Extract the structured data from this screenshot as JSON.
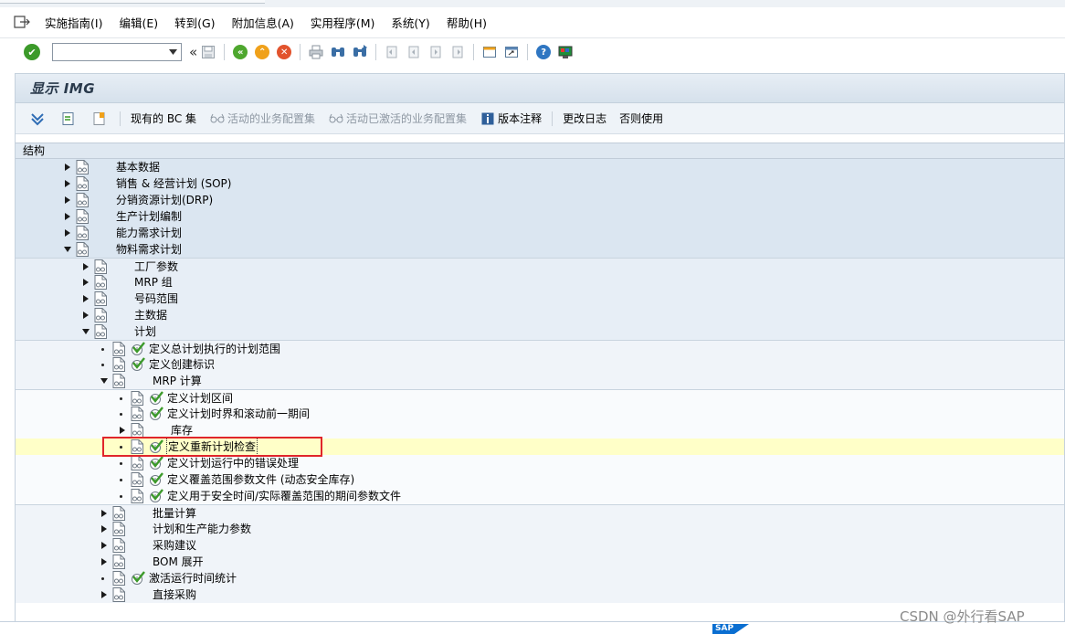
{
  "menubar": {
    "icon": "exit-menu-icon",
    "items": [
      "实施指南(I)",
      "编辑(E)",
      "转到(G)",
      "附加信息(A)",
      "实用程序(M)",
      "系统(Y)",
      "帮助(H)"
    ]
  },
  "toolbar": {
    "command_field_value": "",
    "chevron": "«"
  },
  "screen": {
    "title": "显示 IMG",
    "app_buttons": [
      {
        "label": "现有的 BC 集",
        "enabled": true
      },
      {
        "label": "活动的业务配置集",
        "enabled": false
      },
      {
        "label": "活动已激活的业务配置集",
        "enabled": false
      },
      {
        "label": "版本注释",
        "enabled": true
      },
      {
        "label": "更改日志",
        "enabled": true
      },
      {
        "label": "否则使用",
        "enabled": true
      }
    ],
    "tree_header": "结构"
  },
  "tree": [
    {
      "label": "基本数据",
      "level": 1,
      "exp": "collapsed",
      "activity": false
    },
    {
      "label": "销售 & 经营计划 (SOP)",
      "level": 1,
      "exp": "collapsed",
      "activity": false
    },
    {
      "label": "分销资源计划(DRP)",
      "level": 1,
      "exp": "collapsed",
      "activity": false
    },
    {
      "label": "生产计划编制",
      "level": 1,
      "exp": "collapsed",
      "activity": false
    },
    {
      "label": "能力需求计划",
      "level": 1,
      "exp": "collapsed",
      "activity": false
    },
    {
      "label": "物料需求计划",
      "level": 1,
      "exp": "expanded",
      "activity": false
    },
    {
      "label": "工厂参数",
      "level": 2,
      "exp": "collapsed",
      "activity": false
    },
    {
      "label": "MRP 组",
      "level": 2,
      "exp": "collapsed",
      "activity": false
    },
    {
      "label": "号码范围",
      "level": 2,
      "exp": "collapsed",
      "activity": false
    },
    {
      "label": "主数据",
      "level": 2,
      "exp": "collapsed",
      "activity": false
    },
    {
      "label": "计划",
      "level": 2,
      "exp": "expanded",
      "activity": false
    },
    {
      "label": "定义总计划执行的计划范围",
      "level": 3,
      "exp": "leaf",
      "activity": true
    },
    {
      "label": "定义创建标识",
      "level": 3,
      "exp": "leaf",
      "activity": true
    },
    {
      "label": "MRP 计算",
      "level": 3,
      "exp": "expanded",
      "activity": false
    },
    {
      "label": "定义计划区间",
      "level": 4,
      "exp": "leaf",
      "activity": true
    },
    {
      "label": "定义计划时界和滚动前一期间",
      "level": 4,
      "exp": "leaf",
      "activity": true
    },
    {
      "label": "库存",
      "level": 4,
      "exp": "collapsed",
      "activity": false
    },
    {
      "label": "定义重新计划检查",
      "level": 4,
      "exp": "leaf",
      "activity": true,
      "selected": true
    },
    {
      "label": "定义计划运行中的错误处理",
      "level": 4,
      "exp": "leaf",
      "activity": true
    },
    {
      "label": "定义覆盖范围参数文件 (动态安全库存)",
      "level": 4,
      "exp": "leaf",
      "activity": true
    },
    {
      "label": "定义用于安全时间/实际覆盖范围的期间参数文件",
      "level": 4,
      "exp": "leaf",
      "activity": true
    },
    {
      "label": "批量计算",
      "level": 3,
      "exp": "collapsed",
      "activity": false
    },
    {
      "label": "计划和生产能力参数",
      "level": 3,
      "exp": "collapsed",
      "activity": false
    },
    {
      "label": "采购建议",
      "level": 3,
      "exp": "collapsed",
      "activity": false
    },
    {
      "label": "BOM 展开",
      "level": 3,
      "exp": "collapsed",
      "activity": false
    },
    {
      "label": "激活运行时间统计",
      "level": 3,
      "exp": "leaf",
      "activity": true
    },
    {
      "label": "直接采购",
      "level": 3,
      "exp": "collapsed",
      "activity": false
    }
  ],
  "footer": {
    "sap_logo": "SAP",
    "watermark": "CSDN @外行看SAP"
  },
  "colors": {
    "selection_box": "#e0252b",
    "highlight_row": "#ffffc8",
    "activity_check": "#3c9a2a"
  }
}
